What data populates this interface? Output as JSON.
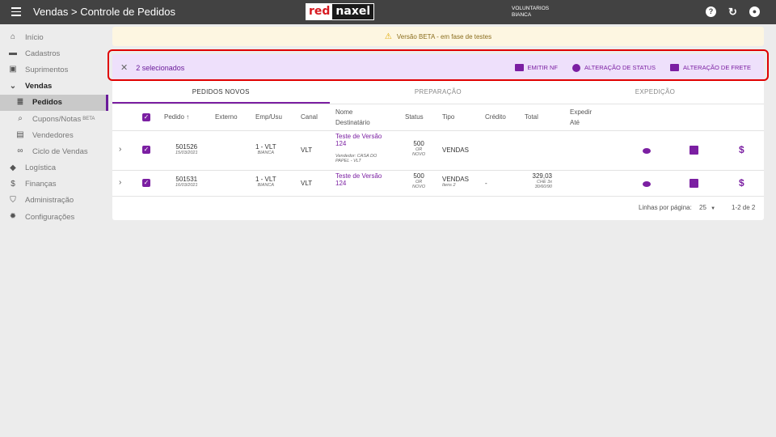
{
  "topbar": {
    "title": "Vendas > Controle de Pedidos",
    "logo_red": "red",
    "logo_naxel": "naxel",
    "user_line1": "VOLUNTARIOS",
    "user_line2": "BIANCA",
    "help_icon": "?",
    "refresh_icon": "↻",
    "account_icon": "●"
  },
  "sidebar": {
    "items": [
      {
        "label": "Início",
        "icon": "home-icon",
        "glyph": "⌂"
      },
      {
        "label": "Cadastros",
        "icon": "folder-icon",
        "glyph": "▬"
      },
      {
        "label": "Suprimentos",
        "icon": "box-icon",
        "glyph": "▣"
      },
      {
        "label": "Vendas",
        "icon": "chevron-down-icon",
        "glyph": "⌄"
      },
      {
        "label": "Pedidos",
        "icon": "list-icon",
        "glyph": "≣"
      },
      {
        "label": "Cupons/Notas",
        "beta": "BETA",
        "icon": "receipt-search-icon",
        "glyph": "⌕"
      },
      {
        "label": "Vendedores",
        "icon": "id-card-icon",
        "glyph": "▤"
      },
      {
        "label": "Ciclo de Vendas",
        "icon": "infinity-icon",
        "glyph": "∞"
      },
      {
        "label": "Logística",
        "icon": "diamond-icon",
        "glyph": "◆"
      },
      {
        "label": "Finanças",
        "icon": "dollar-circle-icon",
        "glyph": "$"
      },
      {
        "label": "Administração",
        "icon": "shield-icon",
        "glyph": "⛉"
      },
      {
        "label": "Configurações",
        "icon": "gear-icon",
        "glyph": "✹"
      }
    ]
  },
  "banner": {
    "text": "Versão BETA - em fase de testes",
    "icon": "warning-icon"
  },
  "selection": {
    "count": "2 selecionados",
    "actions": [
      "EMITIR NF",
      "ALTERAÇÃO DE STATUS",
      "ALTERAÇÃO DE FRETE"
    ]
  },
  "tabs": [
    "PEDIDOS NOVOS",
    "PREPARAÇÃO",
    "EXPEDIÇÃO"
  ],
  "table": {
    "headers": {
      "pedido": "Pedido ↑",
      "externo": "Externo",
      "empusu": "Emp/Usu",
      "canal": "Canal",
      "nome": "Nome",
      "destinatario": "Destinatário",
      "status": "Status",
      "tipo": "Tipo",
      "credito": "Crédito",
      "total": "Total",
      "expedir": "Expedir",
      "ate": "Até"
    },
    "rows": [
      {
        "pedido": "501526",
        "data": "15/03/2021",
        "emp": "1 - VLT",
        "usu": "BIANCA",
        "canal": "VLT",
        "nome_line1": "Teste de Versão",
        "nome_line2": "124",
        "vendedor_line1": "Vendedor: CASA DO",
        "vendedor_line2": "PAPEL - VLT",
        "status": "500",
        "status_sub1": "OR",
        "status_sub2": "NOVO",
        "tipo": "VENDAS",
        "tipo_sub": "",
        "credito": "",
        "total": "",
        "total_sub1": "",
        "total_sub2": ""
      },
      {
        "pedido": "501531",
        "data": "16/03/2021",
        "emp": "1 - VLT",
        "usu": "BIANCA",
        "canal": "VLT",
        "nome_line1": "Teste de Versão",
        "nome_line2": "124",
        "vendedor_line1": "",
        "vendedor_line2": "",
        "status": "500",
        "status_sub1": "OR",
        "status_sub2": "NOVO",
        "tipo": "VENDAS",
        "tipo_sub": "Itens 2",
        "credito": "-",
        "total": "329,03",
        "total_sub1": "CHE 3x",
        "total_sub2": "30/60/90"
      }
    ]
  },
  "footer": {
    "rows_label": "Linhas por página:",
    "rows_value": "25",
    "range": "1-2 de 2"
  }
}
